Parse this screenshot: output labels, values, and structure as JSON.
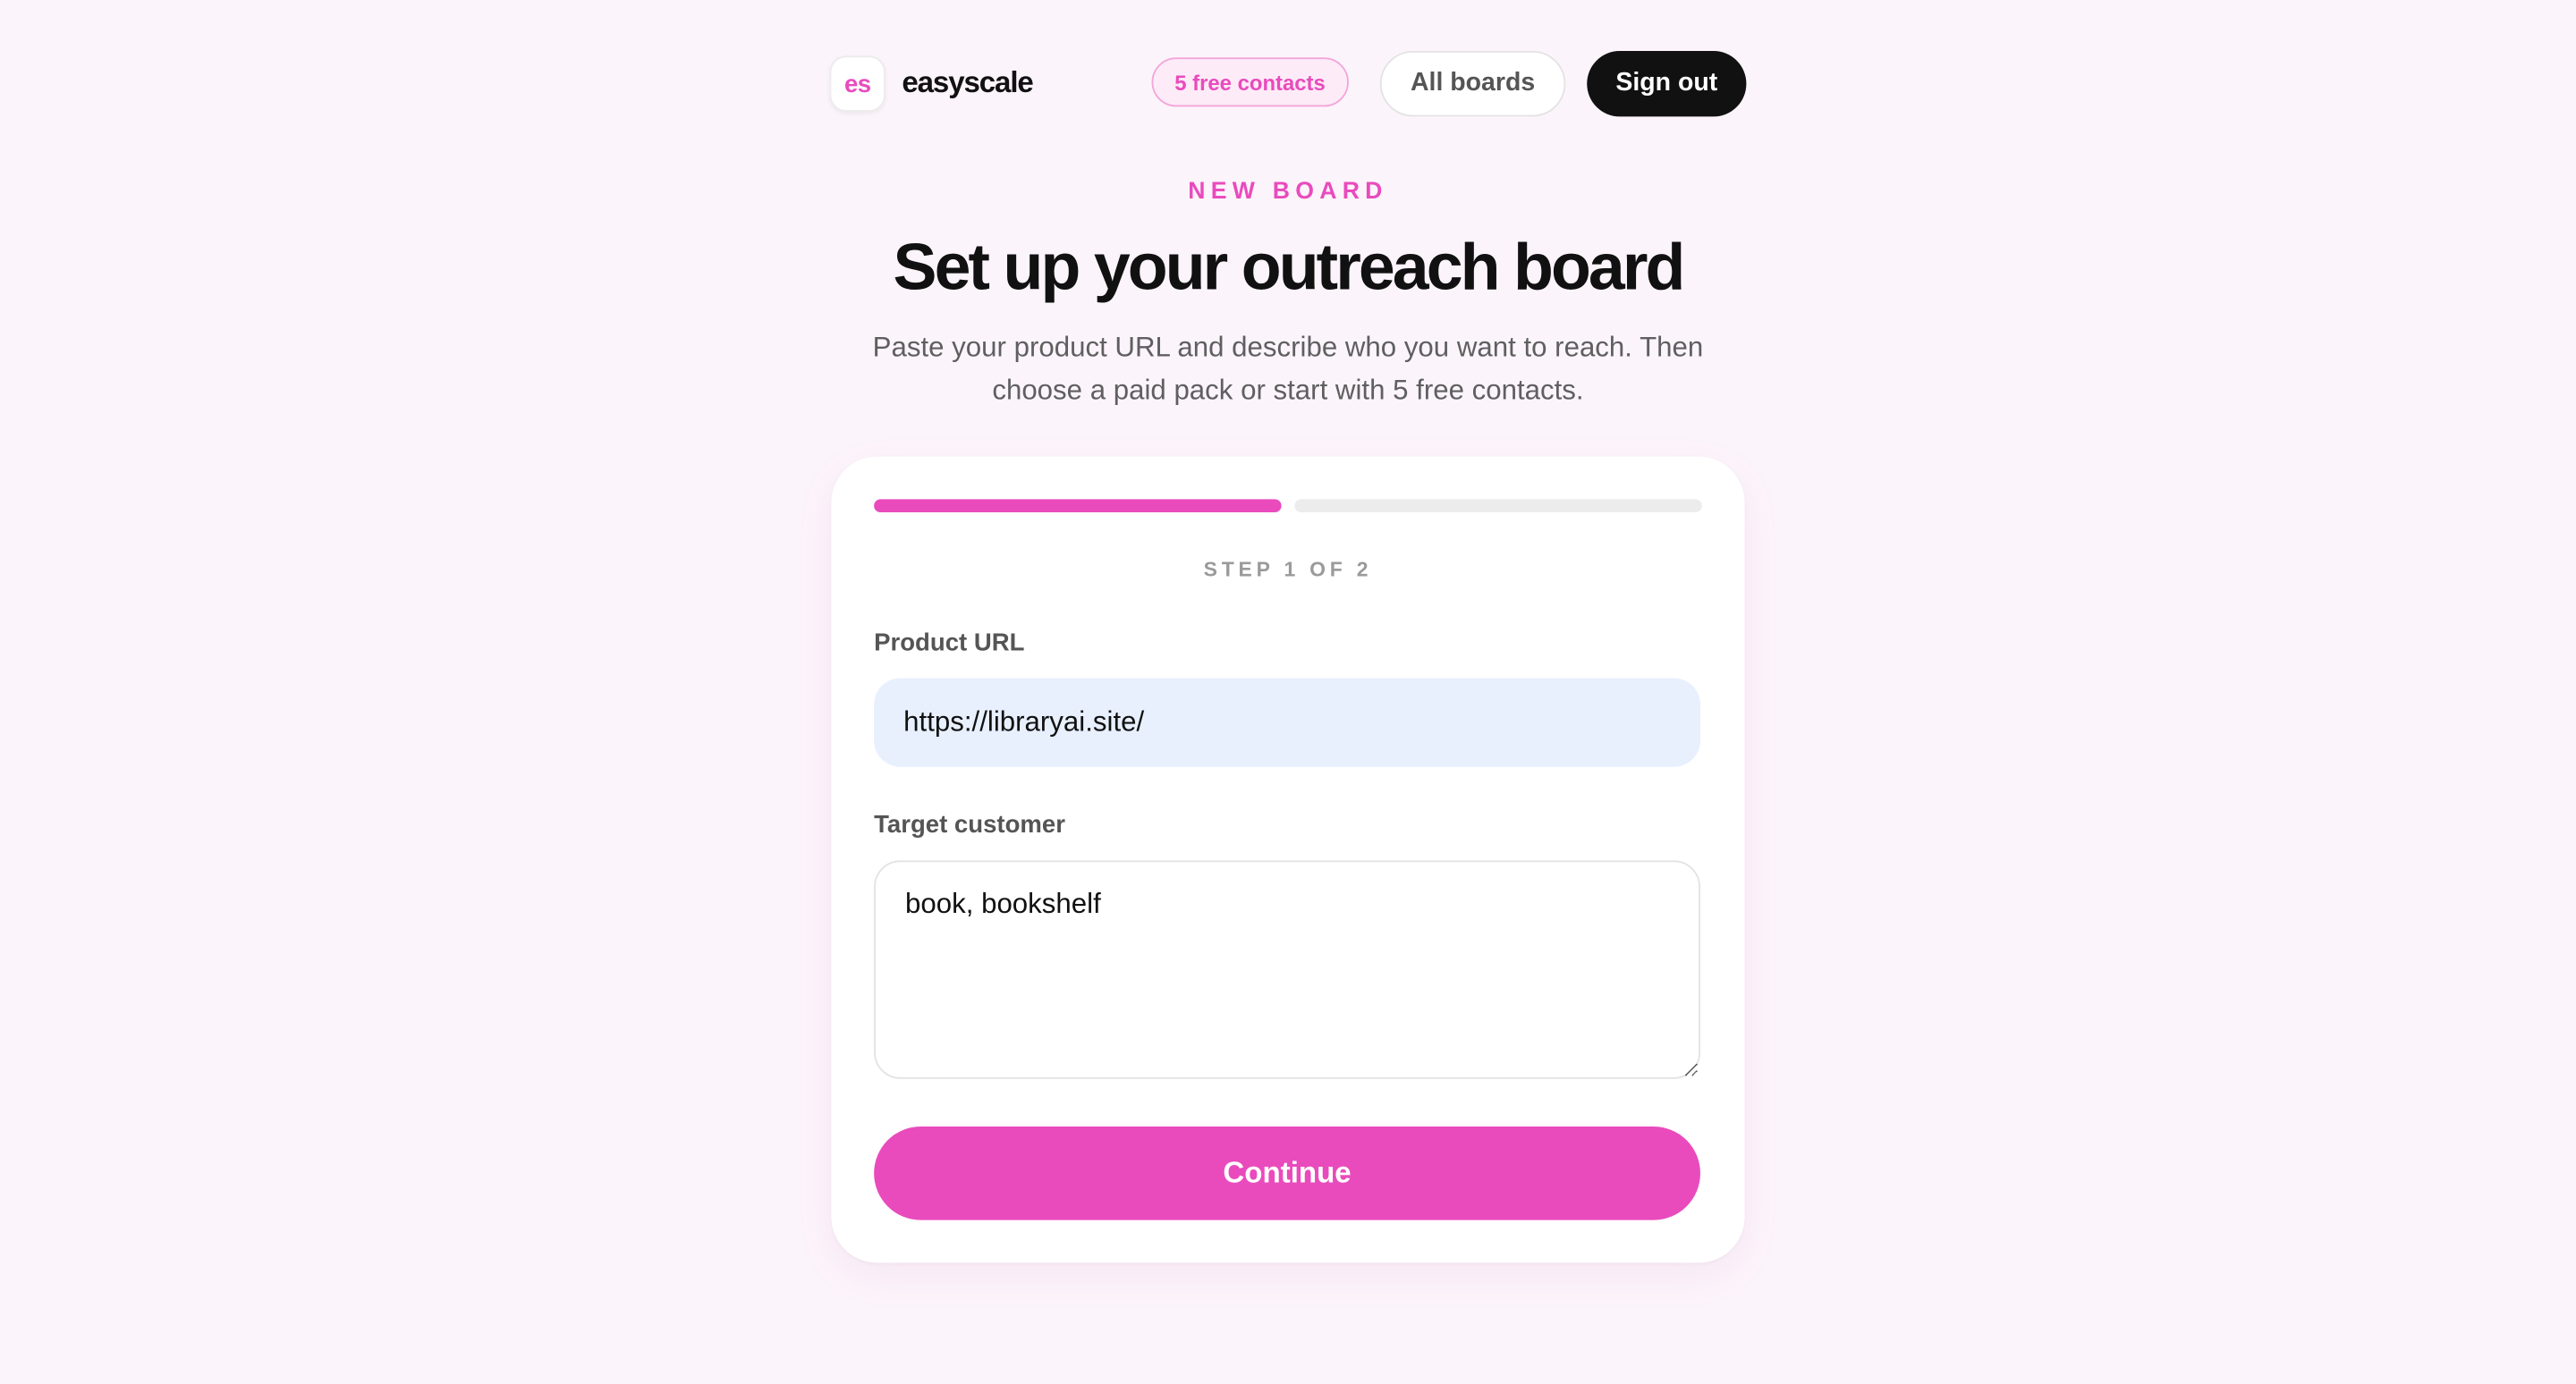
{
  "header": {
    "logo_mark": "es",
    "logo_text": "easyscale",
    "free_badge": "5 free contacts",
    "all_boards_label": "All boards",
    "sign_out_label": "Sign out"
  },
  "hero": {
    "eyebrow": "NEW BOARD",
    "title": "Set up your outreach board",
    "subtitle": "Paste your product URL and describe who you want to reach. Then choose a paid pack or start with 5 free contacts."
  },
  "form": {
    "progress": {
      "current_step": 1,
      "total_steps": 2
    },
    "step_label": "STEP 1 OF 2",
    "product_url": {
      "label": "Product URL",
      "value": "https://libraryai.site/"
    },
    "target_customer": {
      "label": "Target customer",
      "value": "book, bookshelf"
    },
    "continue_label": "Continue"
  },
  "colors": {
    "accent": "#e94bbd",
    "background": "#fcf4fb",
    "dark_button": "#111111",
    "input_autofill": "#e8f0fe"
  }
}
